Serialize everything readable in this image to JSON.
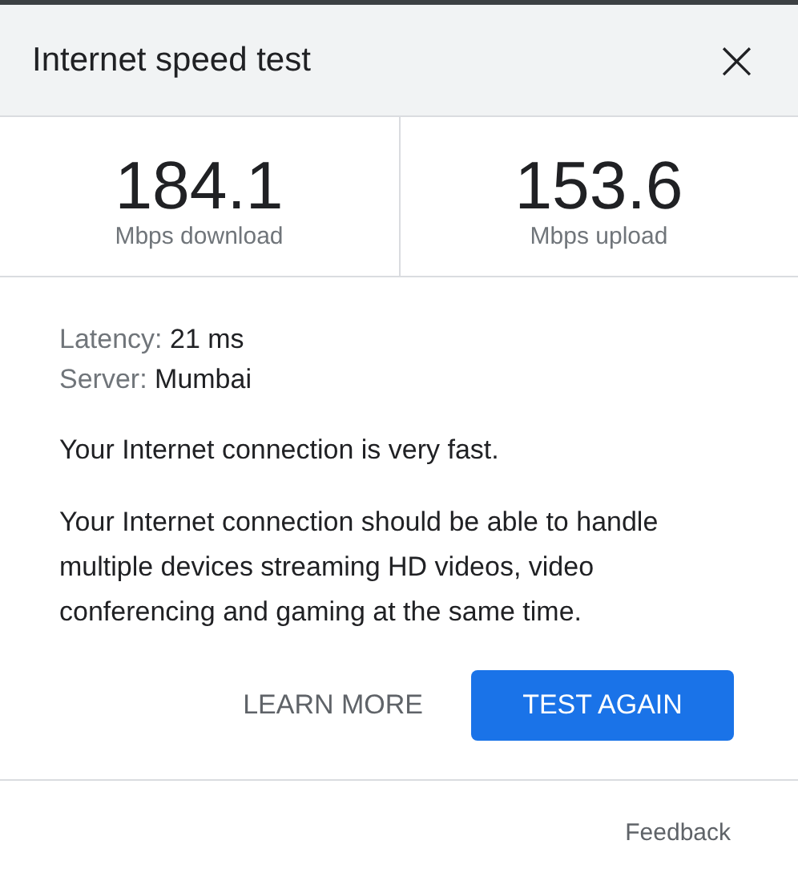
{
  "dialog": {
    "title": "Internet speed test",
    "close": "×"
  },
  "results": [
    {
      "value": "184.1",
      "unit": "Mbps download"
    },
    {
      "value": "153.6",
      "unit": "Mbps upload"
    }
  ],
  "details": [
    {
      "label": "Latency:",
      "value": "21 ms"
    },
    {
      "label": "Server:",
      "value": "Mumbai"
    }
  ],
  "summary": "Your Internet connection is very fast.",
  "description": "Your Internet connection should be able to handle multiple devices streaming HD videos, video conferencing and gaming at the same time.",
  "buttons": [
    {
      "label": "LEARN MORE",
      "kind": "text"
    },
    {
      "label": "TEST AGAIN",
      "kind": "primary"
    }
  ],
  "footer": {
    "link": "Feedback"
  }
}
